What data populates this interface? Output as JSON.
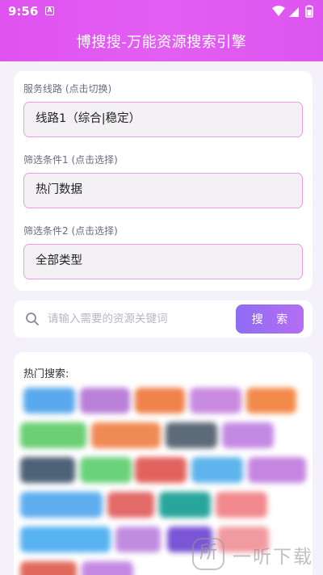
{
  "status_bar": {
    "time": "9:56",
    "notification_icon": "A",
    "icons": [
      "wifi-icon",
      "signal-icon",
      "battery-icon"
    ]
  },
  "header": {
    "title": "博搜搜-万能资源搜索引擎",
    "color": "#e35ef3"
  },
  "selectors": [
    {
      "label": "服务线路 (点击切换)",
      "value": "线路1（综合|稳定）"
    },
    {
      "label": "筛选条件1 (点击选择)",
      "value": "热门数据"
    },
    {
      "label": "筛选条件2 (点击选择)",
      "value": "全部类型"
    }
  ],
  "search": {
    "placeholder": "请输入需要的资源关键词",
    "button_label": "搜 索",
    "accent": "#9d6cf3"
  },
  "hot": {
    "title": "热门搜索:",
    "tags": [
      {
        "text": "",
        "color": "#5aa9ec"
      },
      {
        "text": "",
        "color": "#b97fd9"
      },
      {
        "text": "",
        "color": "#f0824c"
      },
      {
        "text": "",
        "color": "#c98be0"
      },
      {
        "text": "",
        "color": "#f38a4b"
      },
      {
        "text": "",
        "color": "#6ccf74"
      },
      {
        "text": "",
        "color": "#f08a54"
      },
      {
        "text": "",
        "color": "#5d6a78"
      },
      {
        "text": "",
        "color": "#c48ae3"
      },
      {
        "text": "",
        "color": "#4e6277"
      },
      {
        "text": "",
        "color": "#6ad27a"
      },
      {
        "text": "",
        "color": "#e2635e"
      },
      {
        "text": "",
        "color": "#5eb4ec"
      },
      {
        "text": "",
        "color": "#c585e0"
      },
      {
        "text": "",
        "color": "#5faef0"
      },
      {
        "text": "",
        "color": "#e26a68"
      },
      {
        "text": "",
        "color": "#29a69c"
      },
      {
        "text": "",
        "color": "#f2898e"
      },
      {
        "text": "",
        "color": "#58b3f1"
      },
      {
        "text": "",
        "color": "#c28ce1"
      },
      {
        "text": "",
        "color": "#7a55d6"
      },
      {
        "text": "",
        "color": "#f19aa0"
      },
      {
        "text": "",
        "color": "#e26a5d"
      },
      {
        "text": "",
        "color": "#c48ae3"
      }
    ]
  },
  "watermark": {
    "logo": "所",
    "text": "一听下载"
  }
}
